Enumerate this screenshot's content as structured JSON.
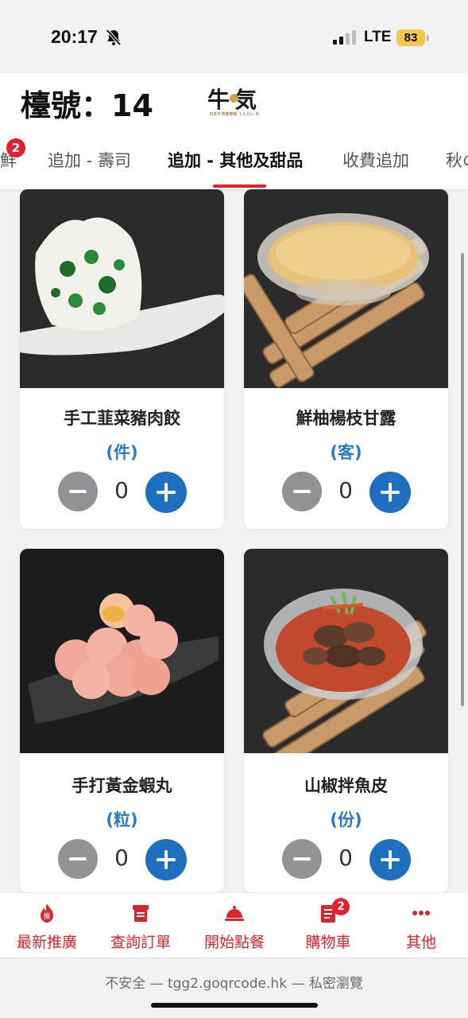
{
  "status_bar": {
    "time": "20:17",
    "network": "LTE",
    "battery": "83"
  },
  "header": {
    "table_label": "檯號：14",
    "logo": {
      "main": "牛気",
      "sub": "日本牛肉蕎麥鍋 うえかい 外"
    }
  },
  "tabs": [
    {
      "label": "鮮",
      "badge": "2"
    },
    {
      "label": "追加 - 壽司"
    },
    {
      "label": "追加 - 其他及甜品",
      "active": true
    },
    {
      "label": "收費追加"
    },
    {
      "label": "秋の"
    }
  ],
  "products": [
    {
      "name": "手工韮菜豬肉餃",
      "unit": "(件)",
      "qty": "0"
    },
    {
      "name": "鮮柚楊枝甘露",
      "unit": "(客)",
      "qty": "0"
    },
    {
      "name": "手打黃金蝦丸",
      "unit": "(粒)",
      "qty": "0"
    },
    {
      "name": "山椒拌魚皮",
      "unit": "(份)",
      "qty": "0"
    }
  ],
  "bottom_nav": [
    {
      "label": "最新推廣",
      "icon": "fire-icon"
    },
    {
      "label": "查詢訂單",
      "icon": "receipt-icon"
    },
    {
      "label": "開始點餐",
      "icon": "cloche-icon"
    },
    {
      "label": "購物車",
      "icon": "cart-list-icon",
      "badge": "2"
    },
    {
      "label": "其他",
      "icon": "more-icon"
    }
  ],
  "url_bar": {
    "text": "不安全 — tgg2.goqrcode.hk — 私密瀏覽"
  },
  "colors": {
    "accent_red": "#e02030",
    "nav_red": "#d7262e",
    "unit_blue": "#2a7ac4",
    "plus_blue": "#1f6fc0",
    "minus_gray": "#8f9396"
  }
}
